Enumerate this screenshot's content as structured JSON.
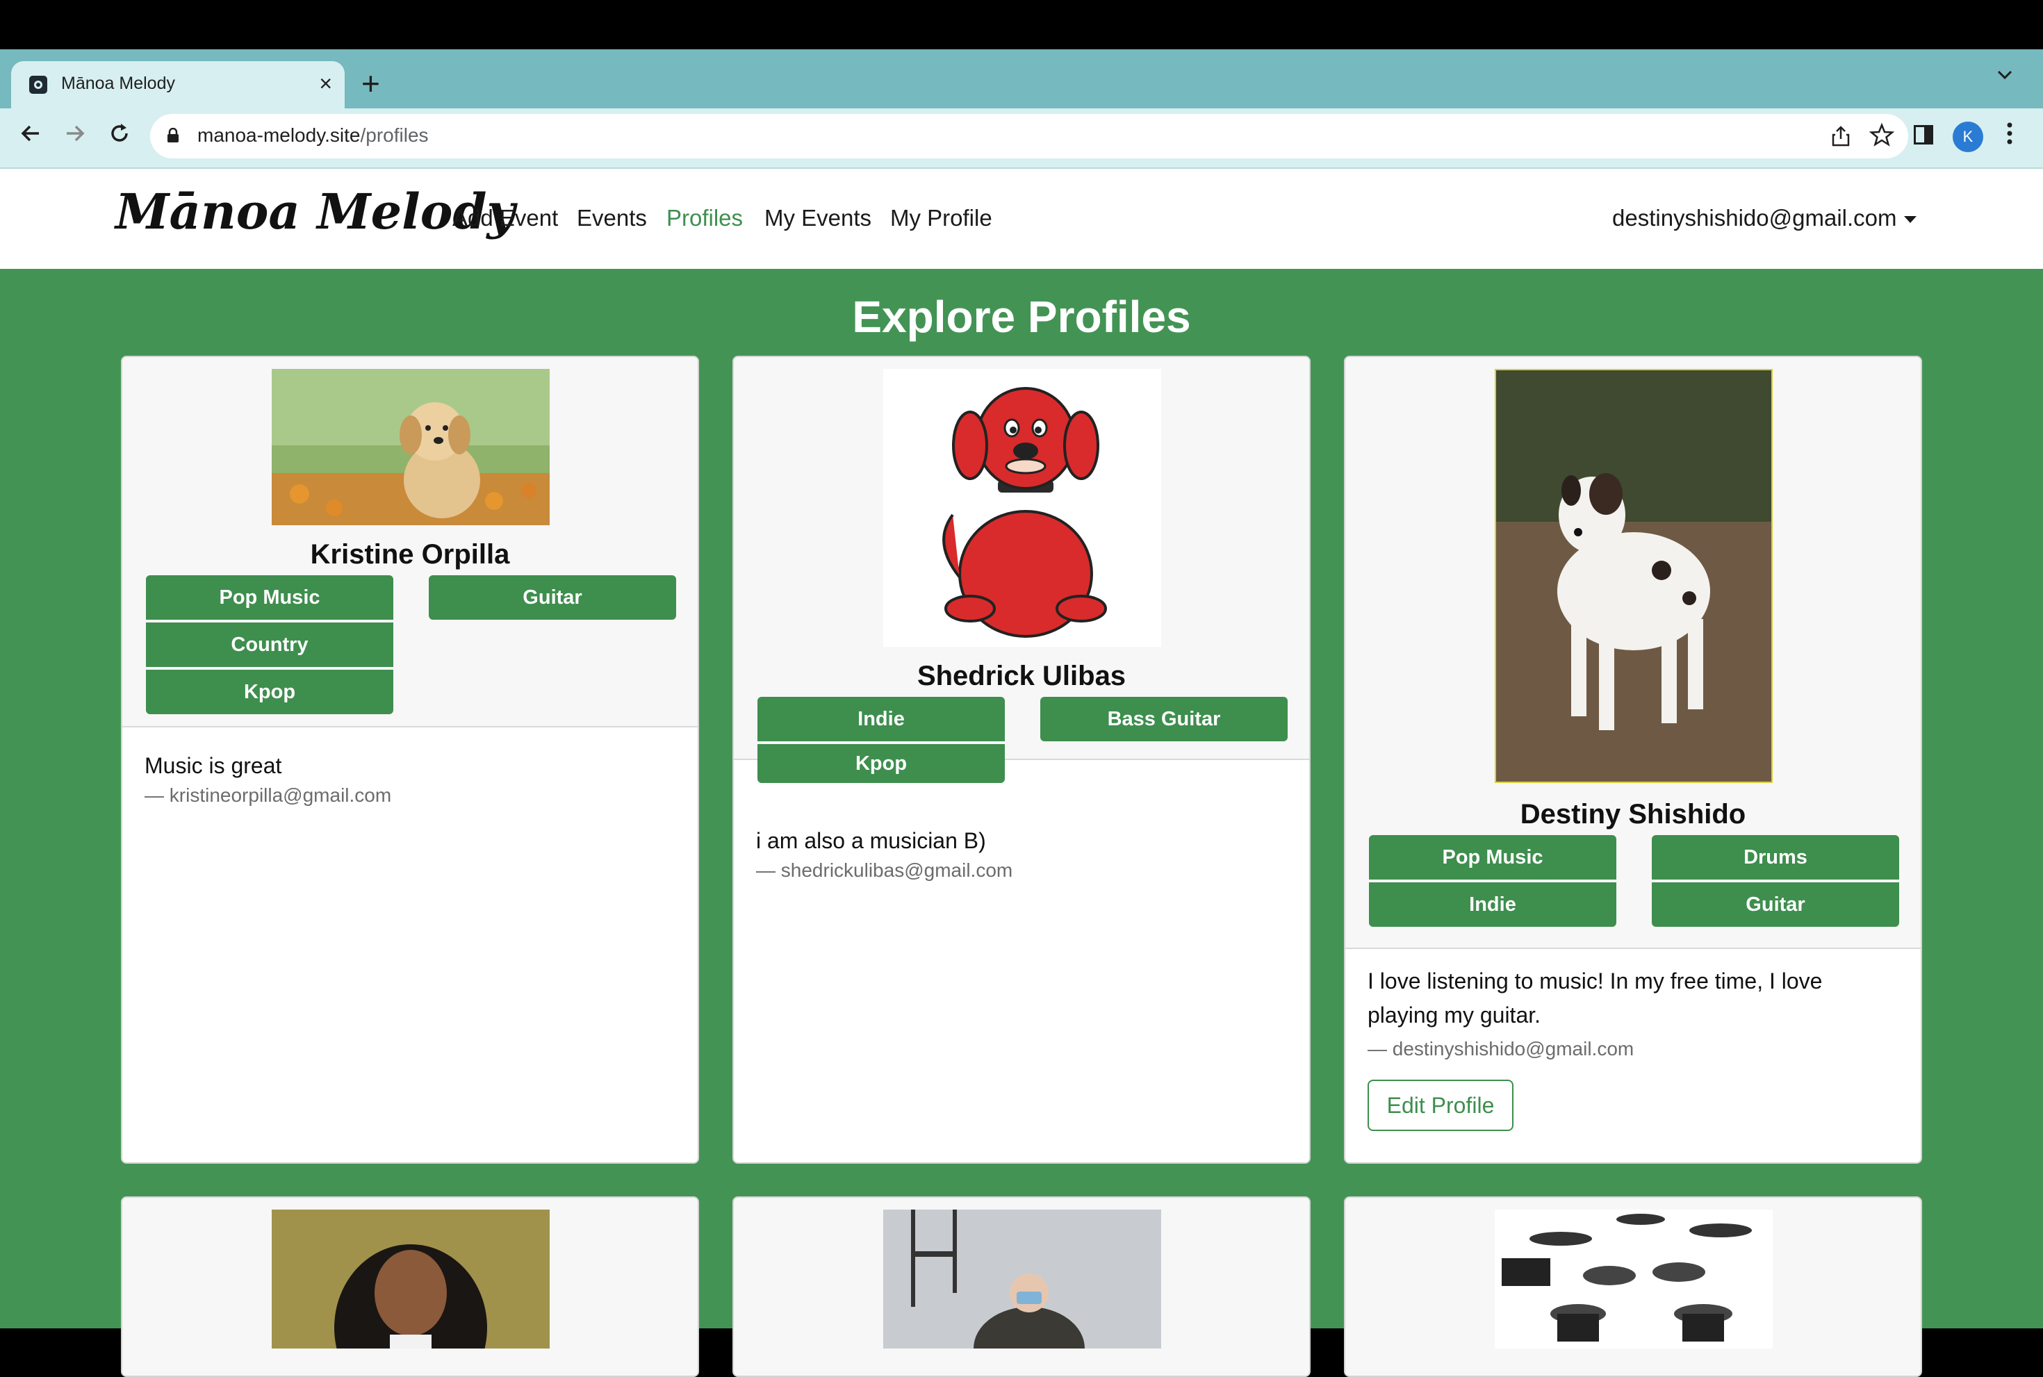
{
  "browser": {
    "tab_title": "Mānoa Melody",
    "tab_close": "×",
    "new_tab": "+",
    "url_host": "manoa-melody.site",
    "url_path": "/profiles",
    "avatar_letter": "K",
    "icons": [
      "back-icon",
      "forward-icon",
      "reload-icon",
      "lock-icon",
      "share-icon",
      "star-icon",
      "side-panel-icon",
      "kebab-menu-icon"
    ]
  },
  "site_nav": {
    "brand": "Mānoa Melody",
    "links": [
      "Add Event",
      "Events",
      "Profiles",
      "My Events",
      "My Profile"
    ],
    "active": "Profiles",
    "user_email": "destinyshishido@gmail.com"
  },
  "page": {
    "title": "Explore Profiles"
  },
  "profiles": [
    {
      "name": "Kristine Orpilla",
      "genres": [
        "Pop Music",
        "Country",
        "Kpop"
      ],
      "instruments": [
        "Guitar"
      ],
      "bio": "Music is great",
      "email": "— kristineorpilla@gmail.com"
    },
    {
      "name": "Shedrick Ulibas",
      "genres": [
        "Indie",
        "Kpop"
      ],
      "instruments": [
        "Bass Guitar"
      ],
      "bio": "i am also a musician B)",
      "email": "— shedrickulibas@gmail.com"
    },
    {
      "name": "Destiny Shishido",
      "genres": [
        "Pop Music",
        "Indie"
      ],
      "instruments": [
        "Drums",
        "Guitar"
      ],
      "bio_line1": "I love listening to music! In my free time, I love",
      "bio_line2": "playing my guitar.",
      "email": "— destinyshishido@gmail.com",
      "edit_label": "Edit Profile"
    }
  ],
  "colors": {
    "page_green": "#439454",
    "chip_green": "#3e8e4e",
    "active_link": "#3f8f4f",
    "tab_strip": "#76b9be"
  }
}
